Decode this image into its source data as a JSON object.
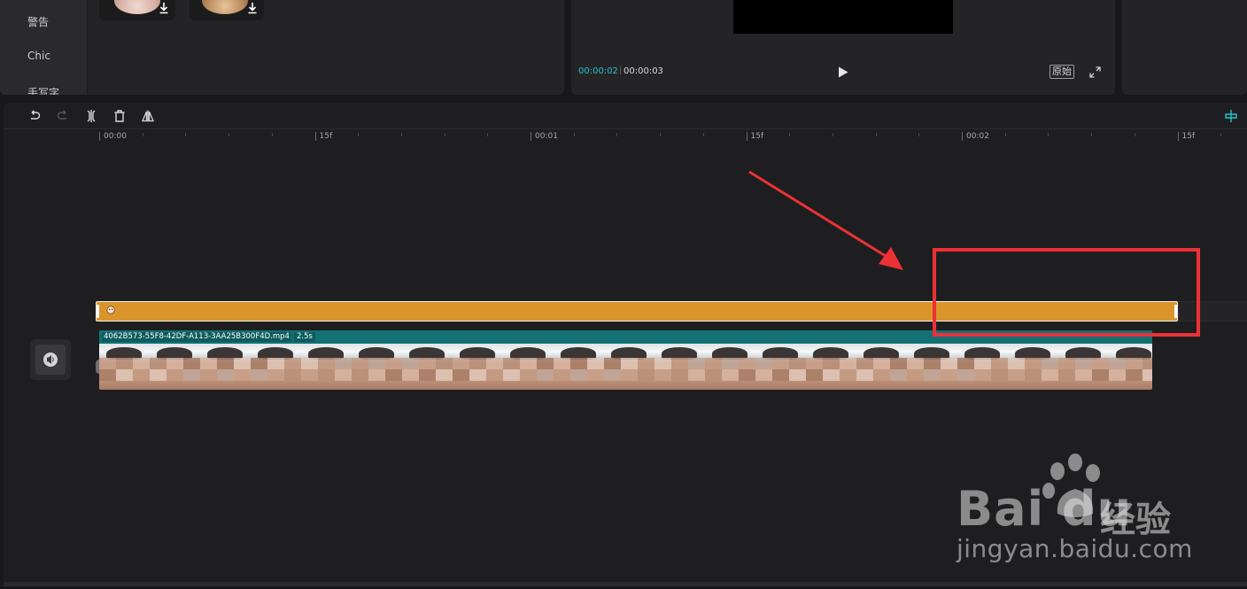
{
  "categories": [
    "警告",
    "Chic",
    "手写字"
  ],
  "preview": {
    "current_time": "00:00:02",
    "separator": "|",
    "total_time": "00:00:03",
    "original_label": "原始"
  },
  "ruler": {
    "labels": [
      "00:00",
      "15f",
      "00:01",
      "15f",
      "00:02",
      "15f"
    ]
  },
  "video_clip": {
    "filename": "4062B573-55F8-42DF-A113-3AA25B300F4D.mp4",
    "duration": "2.5s"
  },
  "watermark": {
    "brand_word": "Bai du",
    "brand_cn": "经验",
    "url": "jingyan.baidu.com"
  },
  "colors": {
    "accent": "#25c4cc",
    "sticker_clip": "#d9952b",
    "video_clip": "#1b7a7e",
    "annotation": "#ec3136"
  },
  "icons": [
    "download-icon",
    "play-icon",
    "fullscreen-icon",
    "undo-icon",
    "redo-icon",
    "split-icon",
    "delete-icon",
    "mirror-icon",
    "snap-icon",
    "volume-icon",
    "sticker-icon"
  ]
}
